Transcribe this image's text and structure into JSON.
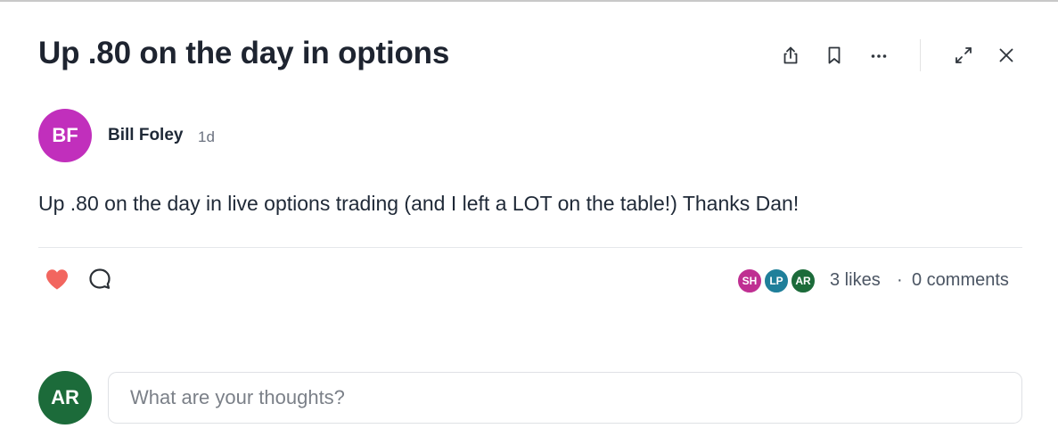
{
  "post": {
    "title": "Up .80 on the day in options",
    "author": {
      "initials": "BF",
      "name": "Bill Foley",
      "avatar_color": "#c12fbc"
    },
    "time": "1d",
    "body": "Up .80 on the day in live options trading (and I left a LOT on the table!) Thanks Dan!"
  },
  "toolbar": {
    "icons": [
      "share-icon",
      "bookmark-icon",
      "more-icon",
      "expand-icon",
      "close-icon"
    ]
  },
  "reactions": {
    "like_icon_color": "#f2665f",
    "likers": [
      {
        "initials": "SH",
        "color": "#bf2f92"
      },
      {
        "initials": "LP",
        "color": "#1f7f9a"
      },
      {
        "initials": "AR",
        "color": "#1c6b3a"
      }
    ],
    "likes_text": "3 likes",
    "separator": "·",
    "comments_text": "0 comments"
  },
  "composer": {
    "user_initials": "AR",
    "user_color": "#1c6b3a",
    "placeholder": "What are your thoughts?"
  }
}
